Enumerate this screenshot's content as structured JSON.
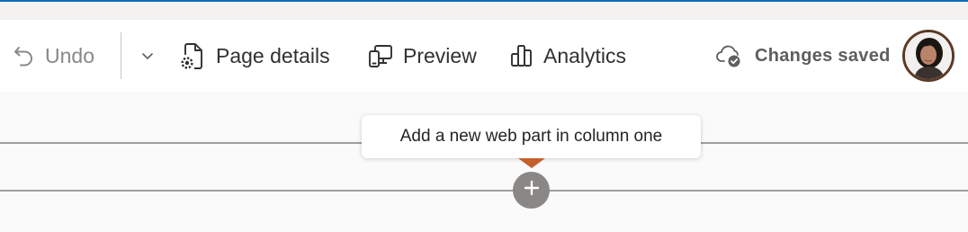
{
  "toolbar": {
    "undo_label": "Undo",
    "page_details_label": "Page details",
    "preview_label": "Preview",
    "analytics_label": "Analytics",
    "status_label": "Changes saved"
  },
  "tooltip": {
    "text": "Add a new web part in column one"
  },
  "icons": {
    "undo": "undo-icon",
    "more": "chevron-down-icon",
    "page_details": "page-settings-icon",
    "preview": "devices-icon",
    "analytics": "bar-chart-icon",
    "saved": "cloud-checkmark-icon",
    "add": "plus-icon"
  },
  "colors": {
    "accent": "#0f6cbd",
    "divider": "#a19f9d",
    "add_button": "#8a8886",
    "avatar_ring": "#5c3a26",
    "tooltip_notch": "#c4612c"
  }
}
